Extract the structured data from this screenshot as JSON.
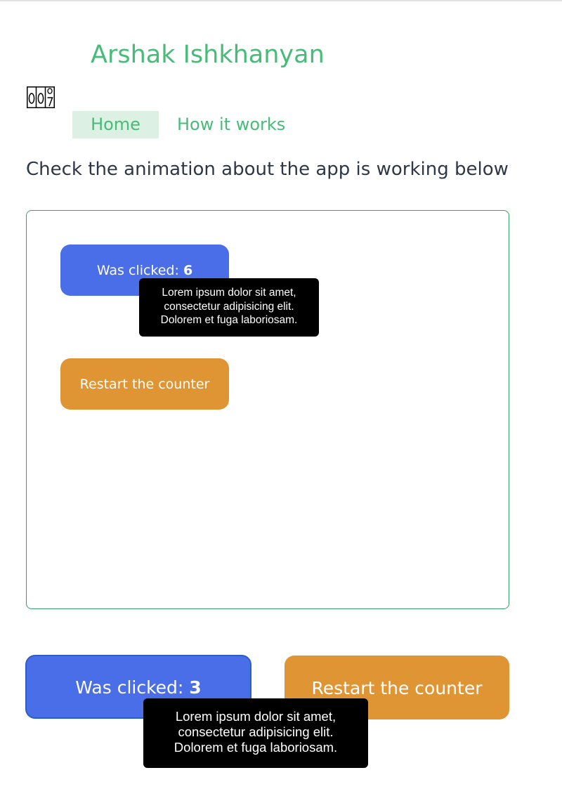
{
  "header": {
    "title": "Arshak Ishkhanyan",
    "logo_text": "007"
  },
  "nav": {
    "items": [
      {
        "label": "Home",
        "active": true
      },
      {
        "label": "How it works",
        "active": false
      }
    ]
  },
  "intro": {
    "text": "Check the animation about the app is working below"
  },
  "demo": {
    "counter_label": "Was clicked: ",
    "counter_value": "6",
    "restart_label": "Restart the counter",
    "tooltip_lines": [
      "Lorem ipsum dolor sit amet,",
      "consectetur adipisicing elit.",
      "Dolorem et fuga laboriosam."
    ]
  },
  "live": {
    "counter_label": "Was clicked: ",
    "counter_value": "3",
    "restart_label": "Restart the counter",
    "tooltip_lines": [
      "Lorem ipsum dolor sit amet,",
      "consectetur adipisicing elit.",
      "Dolorem et fuga laboriosam."
    ]
  },
  "colors": {
    "accent_green": "#48bb78",
    "nav_active_bg": "#dcf1e3",
    "button_blue": "#4a6de8",
    "button_orange": "#e09535",
    "tooltip_bg": "#000000",
    "text_dark": "#2d3748"
  }
}
